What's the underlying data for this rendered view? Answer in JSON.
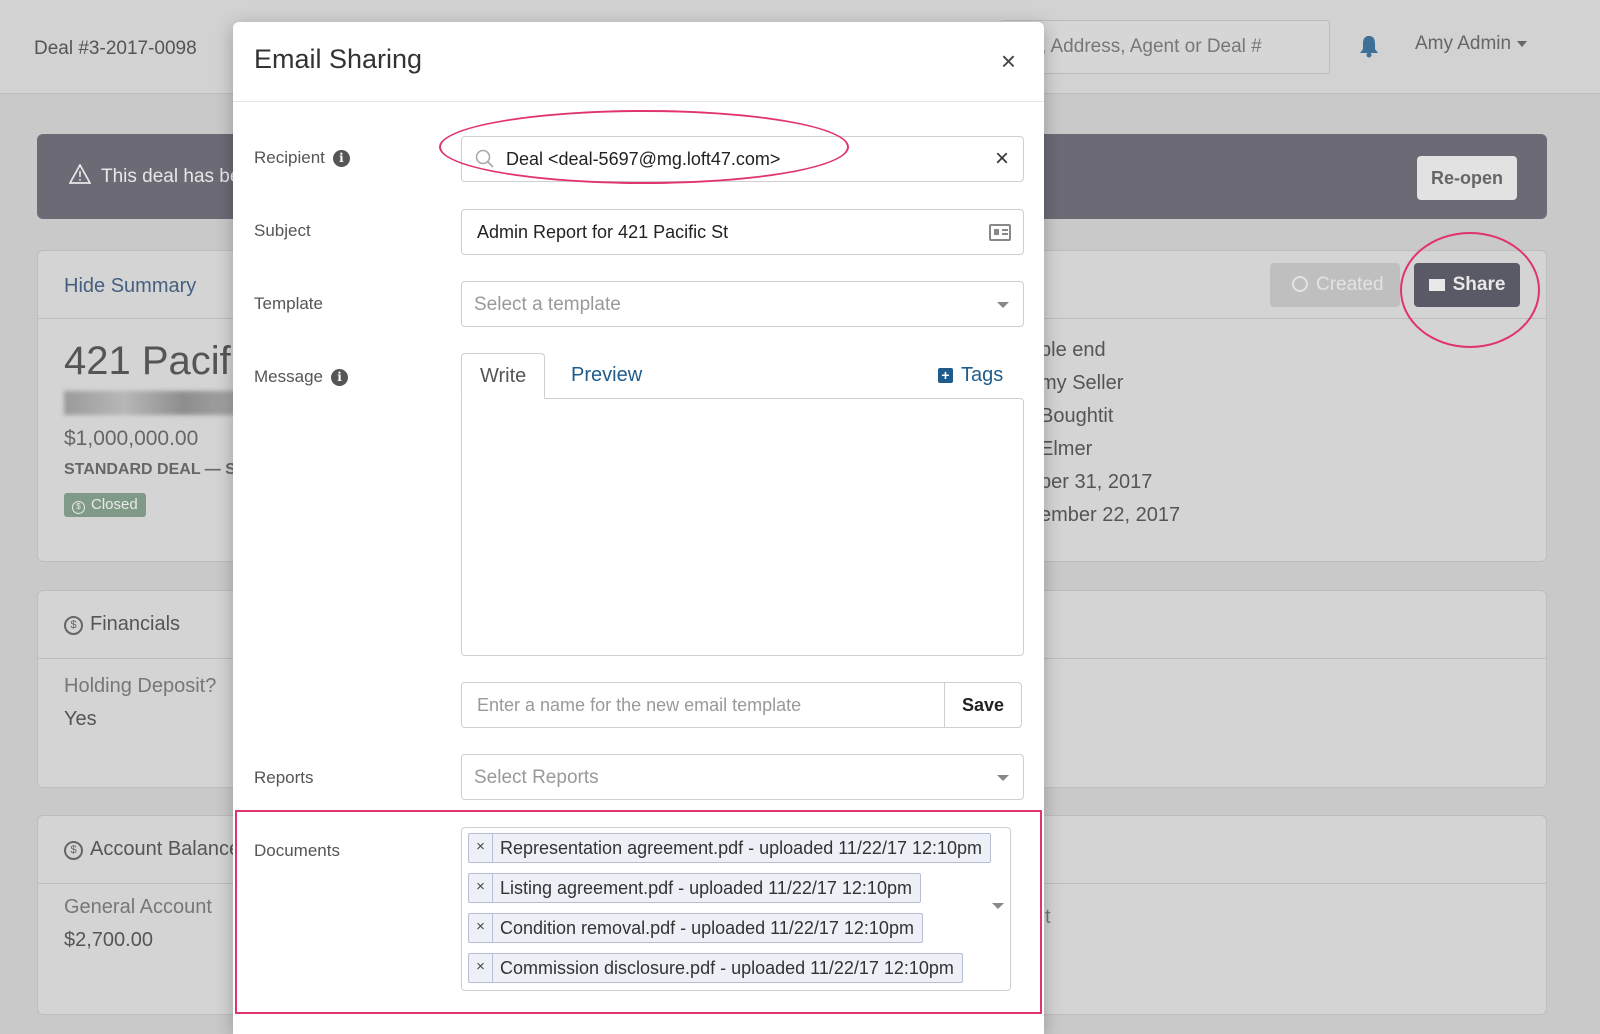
{
  "topbar": {
    "deal_number": "Deal #3-2017-0098",
    "search_fragment": ", Address, Agent or Deal #",
    "user_name": "Amy Admin"
  },
  "alert": {
    "text": "This deal has be",
    "reopen_label": "Re-open"
  },
  "summary": {
    "hide_label": "Hide Summary",
    "created_label": "Created",
    "share_label": "Share",
    "property_title": "421 Pacific",
    "price": "$1,000,000.00",
    "deal_type": "STANDARD DEAL — Si",
    "status": "Closed",
    "details": [
      "ble end",
      "my Seller",
      "Boughtit",
      "Elmer",
      "ber 31, 2017",
      "ember 22, 2017"
    ]
  },
  "financials": {
    "title": "Financials",
    "label": "Holding Deposit?",
    "value": "Yes"
  },
  "account": {
    "title": "Account Balance",
    "label": "General Account",
    "value": "$2,700.00",
    "fragment": "t"
  },
  "modal": {
    "title": "Email Sharing",
    "close": "×",
    "recipient": {
      "label": "Recipient",
      "value": "Deal <deal-5697@mg.loft47.com>"
    },
    "subject": {
      "label": "Subject",
      "value": "Admin Report for 421 Pacific St"
    },
    "template": {
      "label": "Template",
      "placeholder": "Select a template"
    },
    "message": {
      "label": "Message",
      "tab_write": "Write",
      "tab_preview": "Preview",
      "tags_label": "Tags"
    },
    "template_name": {
      "placeholder": "Enter a name for the new email template",
      "save_label": "Save"
    },
    "reports": {
      "label": "Reports",
      "placeholder": "Select Reports"
    },
    "documents": {
      "label": "Documents",
      "items": [
        "Representation agreement.pdf - uploaded 11/22/17 12:10pm",
        "Listing agreement.pdf - uploaded 11/22/17 12:10pm",
        "Condition removal.pdf - uploaded 11/22/17 12:10pm",
        "Commission disclosure.pdf - uploaded 11/22/17 12:10pm"
      ]
    }
  },
  "colors": {
    "accent_blue": "#1f5c8c",
    "annotation_pink": "#e0336f",
    "share_button": "#5a5966"
  }
}
